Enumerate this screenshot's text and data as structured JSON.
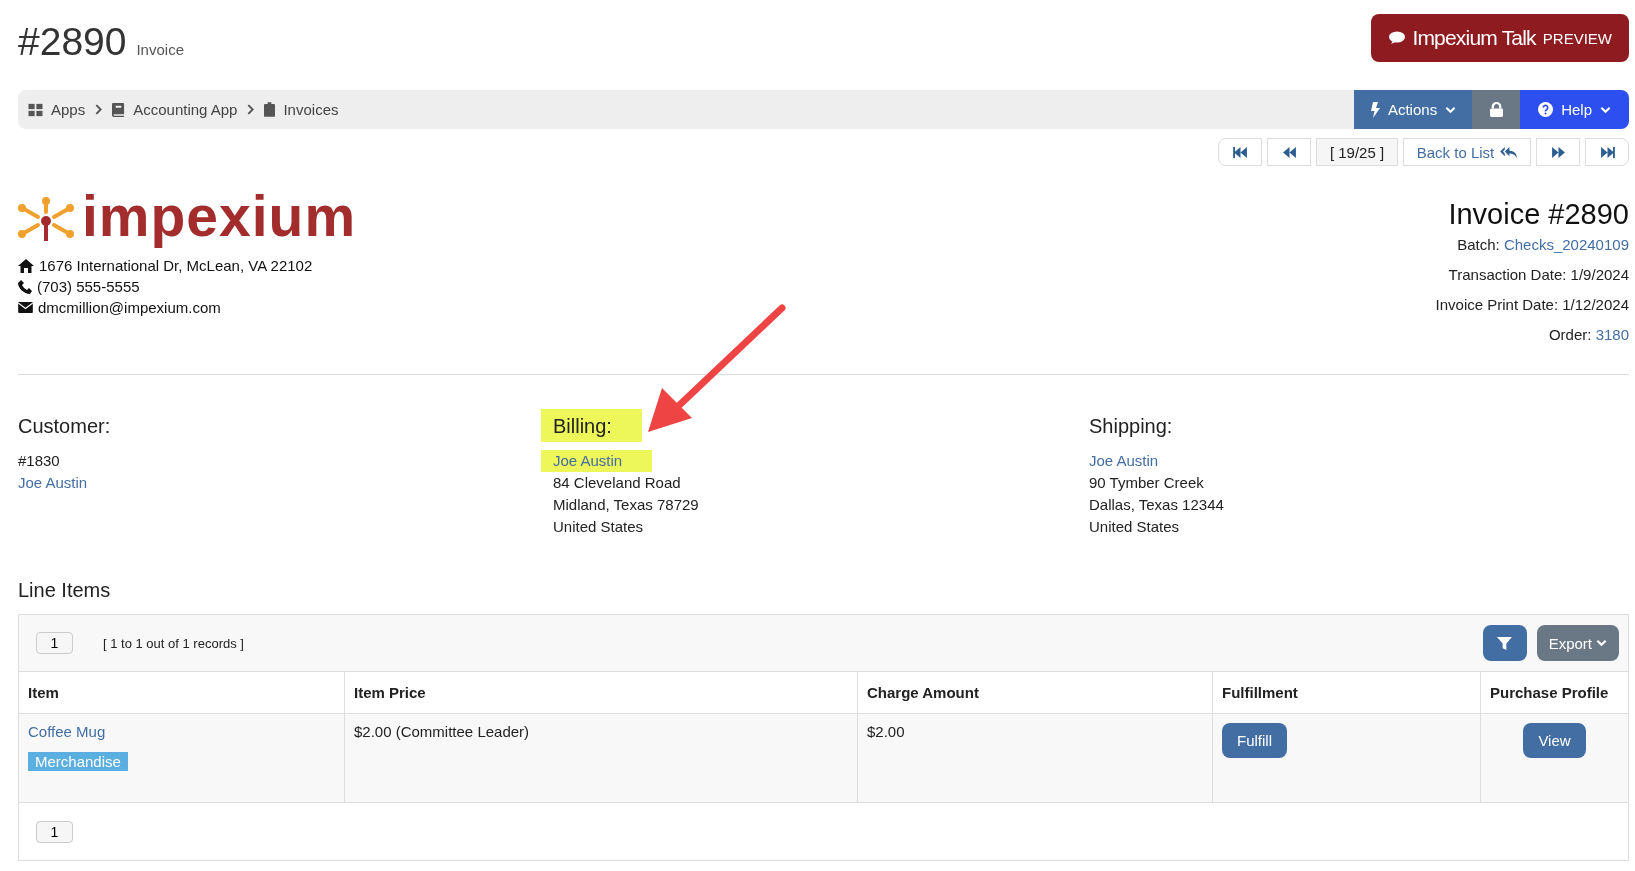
{
  "page_title": {
    "number": "#2890",
    "subtitle": "Invoice"
  },
  "talk_button": {
    "label": "Impexium Talk",
    "badge": "PREVIEW"
  },
  "breadcrumb": [
    {
      "label": "Apps"
    },
    {
      "label": "Accounting App"
    },
    {
      "label": "Invoices"
    }
  ],
  "toolbar": {
    "actions": "Actions",
    "help": "Help"
  },
  "pager": {
    "position": "[ 19/25 ]",
    "back": "Back to List"
  },
  "company": {
    "logo_text": "impexium",
    "address": "1676 International Dr, McLean, VA 22102",
    "phone": "(703) 555-5555",
    "email": "dmcmillion@impexium.com"
  },
  "invoice": {
    "title": "Invoice #2890",
    "batch_label": "Batch:",
    "batch": "Checks_20240109",
    "transaction_date": "Transaction Date: 1/9/2024",
    "print_date": "Invoice Print Date: 1/12/2024",
    "order_label": "Order:",
    "order": "3180"
  },
  "parties": [
    {
      "heading": "Customer:",
      "highlighted": false,
      "lines": [
        {
          "kind": "text",
          "text": "#1830",
          "highlighted": false
        },
        {
          "kind": "link",
          "text": "Joe Austin",
          "highlighted": false
        }
      ]
    },
    {
      "heading": "Billing:",
      "highlighted": true,
      "lines": [
        {
          "kind": "link",
          "text": "Joe Austin",
          "highlighted": true
        },
        {
          "kind": "text",
          "text": "84 Cleveland Road",
          "highlighted": false
        },
        {
          "kind": "text",
          "text": "Midland, Texas 78729",
          "highlighted": false
        },
        {
          "kind": "text",
          "text": "United States",
          "highlighted": false
        }
      ]
    },
    {
      "heading": "Shipping:",
      "highlighted": false,
      "lines": [
        {
          "kind": "link",
          "text": "Joe Austin",
          "highlighted": false
        },
        {
          "kind": "text",
          "text": "90 Tymber Creek",
          "highlighted": false
        },
        {
          "kind": "text",
          "text": "Dallas, Texas 12344",
          "highlighted": false
        },
        {
          "kind": "text",
          "text": "United States",
          "highlighted": false
        }
      ]
    }
  ],
  "line_items": {
    "heading": "Line Items",
    "page": "1",
    "records": "[ 1 to 1 out of 1 records ]",
    "export": "Export",
    "footer_page": "1",
    "columns": [
      "Item",
      "Item Price",
      "Charge Amount",
      "Fulfillment",
      "Purchase Profile"
    ],
    "rows": [
      {
        "item": "Coffee Mug",
        "tag": "Merchandise",
        "price": "$2.00 (Committee Leader)",
        "charge": "$2.00",
        "fulfill": "Fulfill",
        "profile": "View"
      }
    ]
  }
}
